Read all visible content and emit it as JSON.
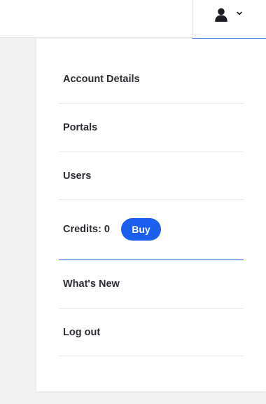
{
  "colors": {
    "accent": "#1a5ff0",
    "divider_active": "#2160d8",
    "text": "#2b2d33",
    "page_background": "#f2f2f2"
  },
  "header": {
    "account_button": {
      "icon": "user-icon",
      "chevron": "chevron-down-icon"
    }
  },
  "menu": {
    "items_top": [
      {
        "label": "Account Details"
      },
      {
        "label": "Portals"
      },
      {
        "label": "Users"
      }
    ],
    "credits": {
      "label": "Credits: 0",
      "buy_label": "Buy"
    },
    "items_bottom": [
      {
        "label": "What's New"
      },
      {
        "label": "Log out"
      }
    ]
  }
}
